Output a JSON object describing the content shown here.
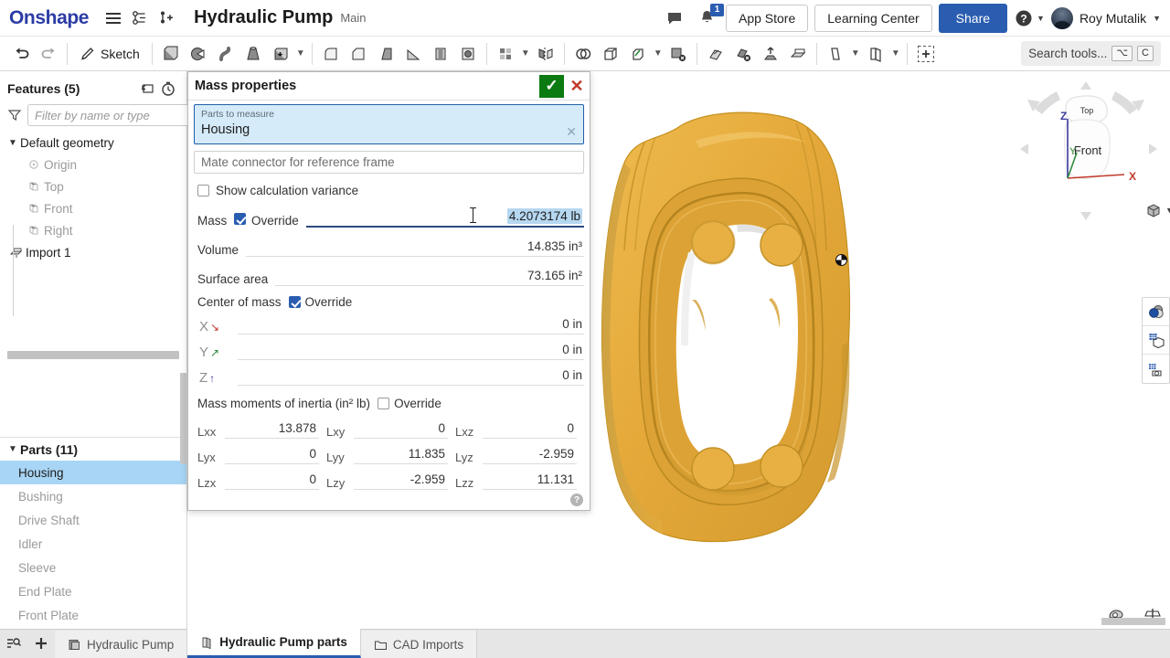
{
  "header": {
    "logo": "Onshape",
    "document_title": "Hydraulic Pump",
    "branch": "Main",
    "notification_count": "1",
    "app_store_label": "App Store",
    "learning_center_label": "Learning Center",
    "share_label": "Share",
    "user_name": "Roy Mutalik",
    "icons": [
      "menu-icon",
      "version-graph-icon",
      "add-branch-icon",
      "comment-icon",
      "bell-icon",
      "help-icon"
    ]
  },
  "toolbar": {
    "undo_label": "Undo",
    "redo_label": "Redo",
    "sketch_label": "Sketch",
    "search_placeholder": "Search tools...",
    "kbd_alt": "⌥",
    "kbd_key": "C",
    "tools": [
      "extrude-icon",
      "revolve-icon",
      "sweep-icon",
      "loft-icon",
      "thicken-icon",
      "fillet-icon",
      "chamfer-icon",
      "draft-icon",
      "rib-icon",
      "shell-icon",
      "hole-icon",
      "pattern-icon",
      "mirror-icon",
      "boolean-icon",
      "enclose-icon",
      "split-icon",
      "delete-face-icon",
      "move-face-icon",
      "delete-part-icon",
      "transform-icon",
      "import-derived-icon",
      "plane-icon",
      "sketch-tools-icon",
      "custom-feature-icon"
    ]
  },
  "features_panel": {
    "title": "Features (5)",
    "filter_placeholder": "Filter by name or type",
    "tree": [
      {
        "label": "Default geometry",
        "icon": "folder-chevron-icon",
        "dim": false,
        "indent": 0
      },
      {
        "label": "Origin",
        "icon": "origin-icon",
        "dim": true,
        "indent": 1
      },
      {
        "label": "Top",
        "icon": "plane-icon",
        "dim": true,
        "indent": 1
      },
      {
        "label": "Front",
        "icon": "plane-icon",
        "dim": true,
        "indent": 1
      },
      {
        "label": "Right",
        "icon": "plane-icon",
        "dim": true,
        "indent": 1
      },
      {
        "label": "Import 1",
        "icon": "import-icon",
        "dim": false,
        "indent": 0
      }
    ]
  },
  "parts_panel": {
    "title": "Parts (11)",
    "items": [
      {
        "label": "Housing",
        "selected": true
      },
      {
        "label": "Bushing",
        "selected": false
      },
      {
        "label": "Drive Shaft",
        "selected": false
      },
      {
        "label": "Idler",
        "selected": false
      },
      {
        "label": "Sleeve",
        "selected": false
      },
      {
        "label": "End Plate",
        "selected": false
      },
      {
        "label": "Front Plate",
        "selected": false
      }
    ]
  },
  "mass_properties": {
    "title": "Mass properties",
    "accept_label": "✓",
    "cancel_label": "✕",
    "parts_field_label": "Parts to measure",
    "parts_field_value": "Housing",
    "parts_field_clear": "✕",
    "mate_connector_placeholder": "Mate connector for reference frame",
    "show_variance_label": "Show calculation variance",
    "show_variance_checked": false,
    "mass_label": "Mass",
    "mass_override_label": "Override",
    "mass_override_checked": true,
    "mass_value": "4.2073174 lb",
    "volume_label": "Volume",
    "volume_value": "14.835 in³",
    "surface_area_label": "Surface area",
    "surface_area_value": "73.165 in²",
    "com_label": "Center of mass",
    "com_override_label": "Override",
    "com_override_checked": true,
    "com_rows": [
      {
        "axis": "X",
        "arrow": "↘",
        "color": "#c0392b",
        "value": "0 in"
      },
      {
        "axis": "Y",
        "arrow": "↗",
        "color": "#2e8b3d",
        "value": "0 in"
      },
      {
        "axis": "Z",
        "arrow": "↑",
        "color": "#3a3a9c",
        "value": "0 in"
      }
    ],
    "inertia_label": "Mass moments of inertia (in² lb)",
    "inertia_override_label": "Override",
    "inertia_override_checked": false,
    "inertia_rows": [
      [
        {
          "label": "Lxx",
          "value": "13.878"
        },
        {
          "label": "Lxy",
          "value": "0"
        },
        {
          "label": "Lxz",
          "value": "0"
        }
      ],
      [
        {
          "label": "Lyx",
          "value": "0"
        },
        {
          "label": "Lyy",
          "value": "11.835"
        },
        {
          "label": "Lyz",
          "value": "-2.959"
        }
      ],
      [
        {
          "label": "Lzx",
          "value": "0"
        },
        {
          "label": "Lzy",
          "value": "-2.959"
        },
        {
          "label": "Lzz",
          "value": "11.131"
        }
      ]
    ],
    "help_label": "?"
  },
  "viewport": {
    "part_color": "#e5a93a",
    "part_color_light": "#eeba4e",
    "part_color_dark": "#c98f27",
    "view_cube": {
      "top_face": "Top",
      "front_face": "Front",
      "axis_x": "X",
      "axis_y": "Y",
      "axis_z": "Z"
    },
    "right_tools": [
      "appearance-icon",
      "section-view-icon",
      "render-view-icon"
    ],
    "bottom_tools": [
      "measure-tape-icon",
      "mass-properties-scale-icon"
    ]
  },
  "tabbar": {
    "list_icon": "tab-list-icon",
    "add_icon": "add-tab-icon",
    "tabs": [
      {
        "label": "Hydraulic Pump",
        "icon": "assembly-icon",
        "active": false
      },
      {
        "label": "Hydraulic Pump parts",
        "icon": "part-studio-icon",
        "active": true
      },
      {
        "label": "CAD Imports",
        "icon": "folder-icon",
        "active": false
      }
    ]
  }
}
